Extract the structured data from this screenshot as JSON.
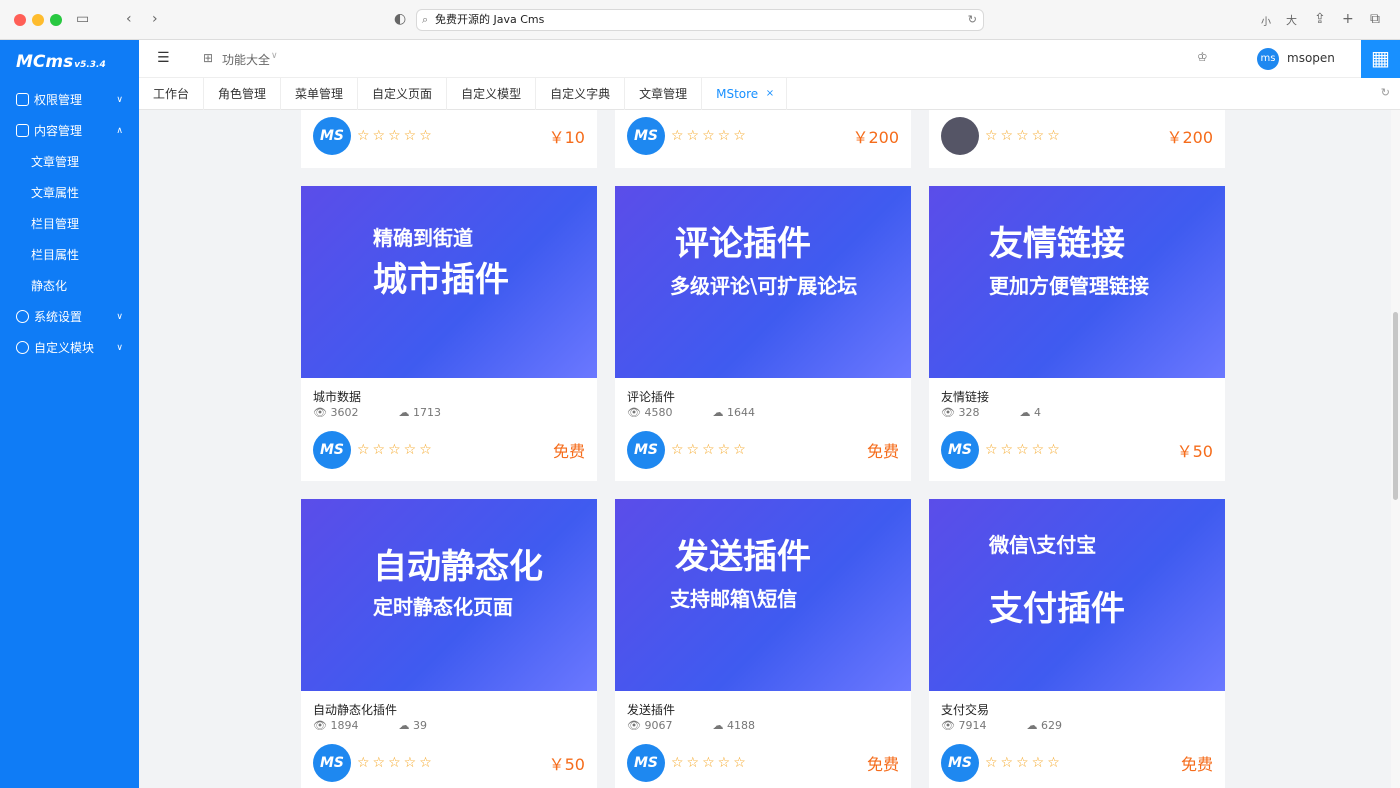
{
  "browser": {
    "url": "免费开源的 Java Cms",
    "font_small": "小",
    "font_large": "大"
  },
  "sidebar": {
    "logo": "MCms",
    "version": "v5.3.4",
    "groups": [
      {
        "label": "权限管理"
      },
      {
        "label": "内容管理",
        "children": [
          "文章管理",
          "文章属性",
          "栏目管理",
          "栏目属性",
          "静态化"
        ]
      },
      {
        "label": "系统设置"
      },
      {
        "label": "自定义模块"
      }
    ]
  },
  "topbar": {
    "menu_label": "功能大全",
    "user": "msopen",
    "avatar": "ms"
  },
  "tabs": [
    "工作台",
    "角色管理",
    "菜单管理",
    "自定义页面",
    "自定义模型",
    "自定义字典",
    "文章管理",
    "MStore"
  ],
  "partial_row": [
    {
      "price": "￥10"
    },
    {
      "price": "￥200"
    },
    {
      "price": "￥200"
    }
  ],
  "cards": [
    {
      "banner_line1": "精确到街道",
      "banner_line2": "城市插件",
      "title": "城市数据",
      "views": "3602",
      "downloads": "1713",
      "price": "免费"
    },
    {
      "banner_line1": "评论插件",
      "banner_line2": "多级评论\\可扩展论坛",
      "title": "评论插件",
      "views": "4580",
      "downloads": "1644",
      "price": "免费"
    },
    {
      "banner_line1": "友情链接",
      "banner_line2": "更加方便管理链接",
      "title": "友情链接",
      "views": "328",
      "downloads": "4",
      "price": "￥50"
    },
    {
      "banner_line1": "自动静态化",
      "banner_line2": "定时静态化页面",
      "title": "自动静态化插件",
      "views": "1894",
      "downloads": "39",
      "price": "￥50"
    },
    {
      "banner_line1": "发送插件",
      "banner_line2": "支持邮箱\\短信",
      "title": "发送插件",
      "views": "9067",
      "downloads": "4188",
      "price": "免费"
    },
    {
      "banner_line1": "微信\\支付宝",
      "banner_line2": "支付插件",
      "title": "支付交易",
      "views": "7914",
      "downloads": "629",
      "price": "免费"
    }
  ],
  "ms_logo": "MS",
  "colors": {
    "sidebar": "#0f7cf6",
    "price": "#f56c1b",
    "active_tab": "#1890ff"
  }
}
